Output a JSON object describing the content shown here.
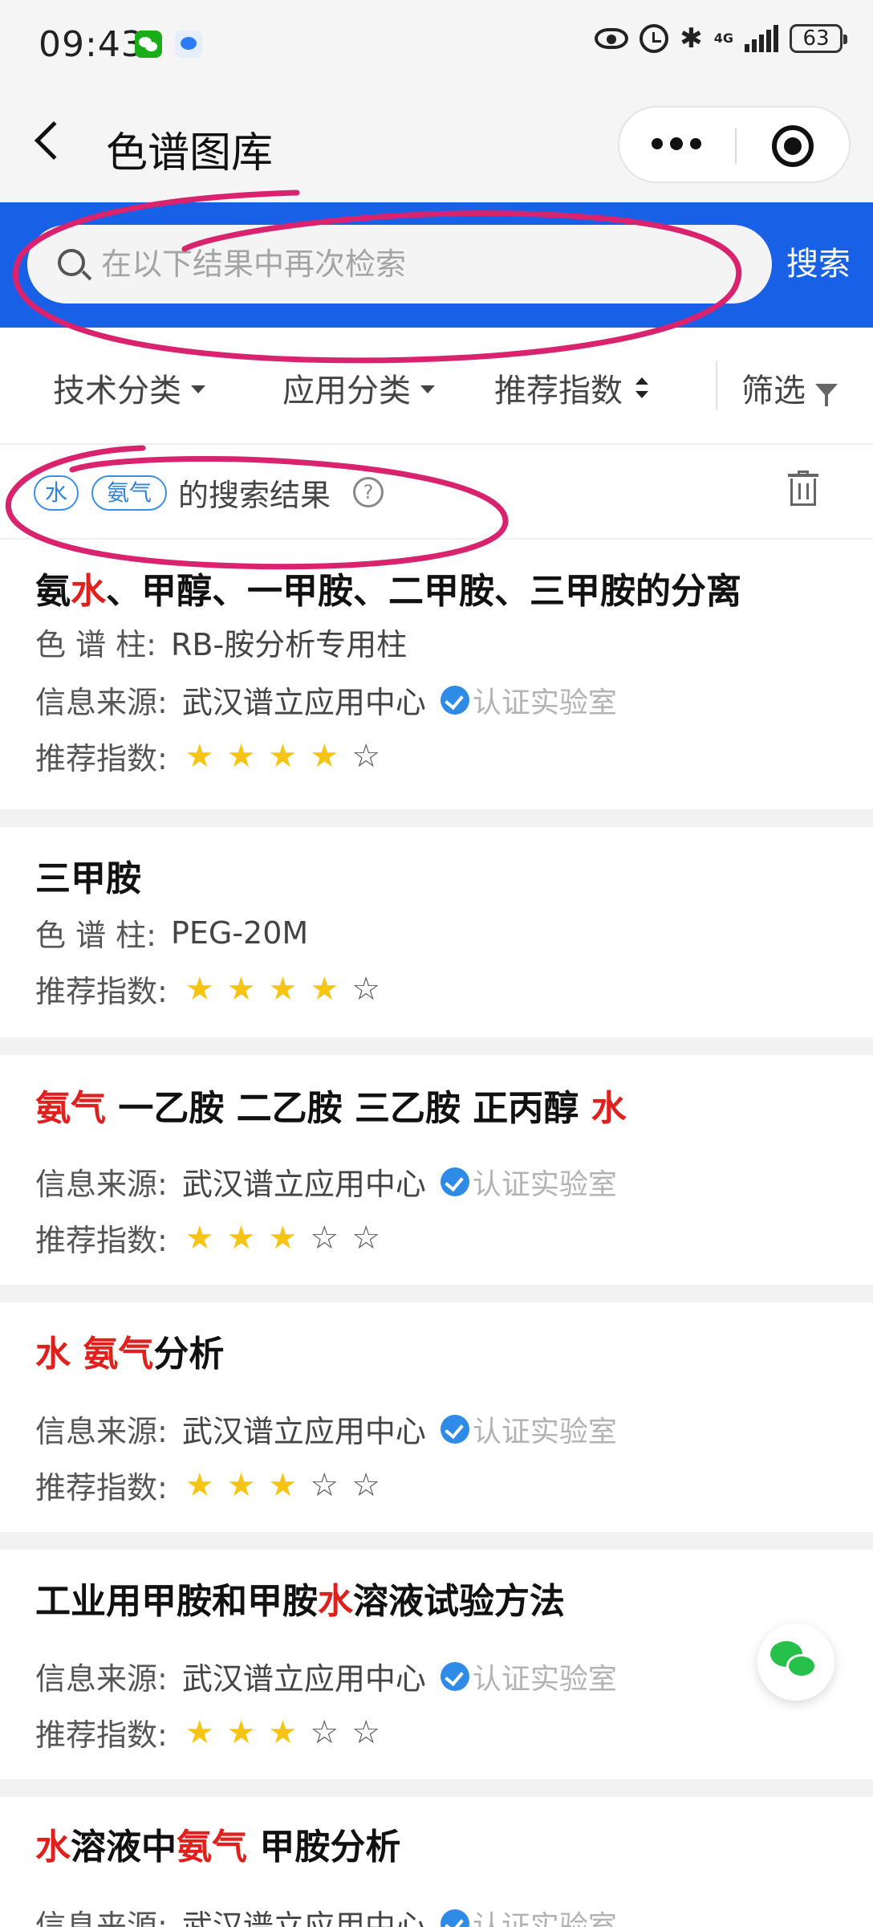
{
  "status_bar": {
    "time": "09:43",
    "network": "4G",
    "battery": "63"
  },
  "nav": {
    "title": "色谱图库"
  },
  "search": {
    "placeholder": "在以下结果中再次检索",
    "value": "",
    "button_label": "搜索"
  },
  "filters": [
    {
      "label": "技术分类",
      "icon": "caret-down-icon"
    },
    {
      "label": "应用分类",
      "icon": "caret-down-icon"
    },
    {
      "label": "推荐指数",
      "icon": "sort-icon"
    },
    {
      "label": "筛选",
      "icon": "funnel-icon"
    }
  ],
  "result_header": {
    "tags": [
      "水",
      "氨气"
    ],
    "label": "的搜索结果",
    "help": "?"
  },
  "labels": {
    "column": "色 谱 柱:",
    "source": "信息来源:",
    "rating": "推荐指数:",
    "verified": "认证实验室"
  },
  "results": [
    {
      "title_parts": [
        {
          "text": "氨",
          "highlight": false
        },
        {
          "text": "水",
          "highlight": true
        },
        {
          "text": "、甲醇、一甲胺、二甲胺、三甲胺的分离",
          "highlight": false
        }
      ],
      "column": "RB-胺分析专用柱",
      "source": "武汉谱立应用中心",
      "verified": true,
      "rating": 4,
      "rating_max": 5
    },
    {
      "title_parts": [
        {
          "text": "三甲胺",
          "highlight": false
        }
      ],
      "column": "PEG-20M",
      "source": "",
      "verified": false,
      "rating": 4,
      "rating_max": 5
    },
    {
      "title_parts": [
        {
          "text": "氨气",
          "highlight": true
        },
        {
          "text": " 一乙胺 二乙胺 三乙胺 正丙醇 ",
          "highlight": false
        },
        {
          "text": "水",
          "highlight": true
        }
      ],
      "column": "",
      "source": "武汉谱立应用中心",
      "verified": true,
      "rating": 3,
      "rating_max": 5
    },
    {
      "title_parts": [
        {
          "text": "水",
          "highlight": true
        },
        {
          "text": " ",
          "highlight": false
        },
        {
          "text": "氨气",
          "highlight": true
        },
        {
          "text": "分析",
          "highlight": false
        }
      ],
      "column": "",
      "source": "武汉谱立应用中心",
      "verified": true,
      "rating": 3,
      "rating_max": 5
    },
    {
      "title_parts": [
        {
          "text": "工业用甲胺和甲胺",
          "highlight": false
        },
        {
          "text": "水",
          "highlight": true
        },
        {
          "text": "溶液试验方法",
          "highlight": false
        }
      ],
      "column": "",
      "source": "武汉谱立应用中心",
      "verified": true,
      "rating": 3,
      "rating_max": 5
    },
    {
      "title_parts": [
        {
          "text": "水",
          "highlight": true
        },
        {
          "text": "溶液中",
          "highlight": false
        },
        {
          "text": "氨气",
          "highlight": true
        },
        {
          "text": " 甲胺分析",
          "highlight": false
        }
      ],
      "column": "",
      "source": "武汉谱立应用中心",
      "verified": true,
      "rating": null,
      "rating_max": 5
    }
  ],
  "colors": {
    "brand_blue": "#1860e6",
    "highlight_red": "#e0201c",
    "star_yellow": "#f6c513",
    "tag_blue": "#2f83d8",
    "annotation_pink": "#d9236e"
  }
}
